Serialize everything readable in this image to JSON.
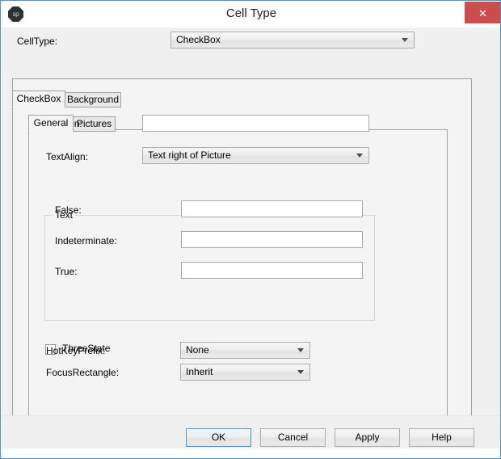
{
  "window": {
    "title": "Cell Type",
    "icon_label": "sp",
    "close_label": "✕",
    "accent_color": "#4a94d4",
    "close_color": "#cc4d4d"
  },
  "celltype_row": {
    "label": "CellType:",
    "value": "CheckBox"
  },
  "outer_tabs": [
    {
      "label": "CheckBox",
      "selected": true
    },
    {
      "label": "Background",
      "selected": false
    }
  ],
  "inner_tabs": [
    {
      "label": "General",
      "selected": true
    },
    {
      "label": "Pictures",
      "selected": false
    }
  ],
  "general": {
    "caption": {
      "label": "Caption:",
      "value": ""
    },
    "textalign": {
      "label": "TextAlign:",
      "value": "Text right of Picture"
    },
    "text_group": {
      "title": "Text",
      "fields": [
        {
          "label": "False:",
          "value": ""
        },
        {
          "label": "Indeterminate:",
          "value": ""
        },
        {
          "label": "True:",
          "value": ""
        }
      ]
    },
    "threestate": {
      "label": "ThreeState",
      "checked": false
    },
    "hotkeyprefix": {
      "label": "HotKeyPrefix:",
      "value": "None"
    },
    "focusrectangle": {
      "label": "FocusRectangle:",
      "value": "Inherit"
    }
  },
  "buttons": {
    "ok": "OK",
    "cancel": "Cancel",
    "apply": "Apply",
    "help": "Help"
  }
}
